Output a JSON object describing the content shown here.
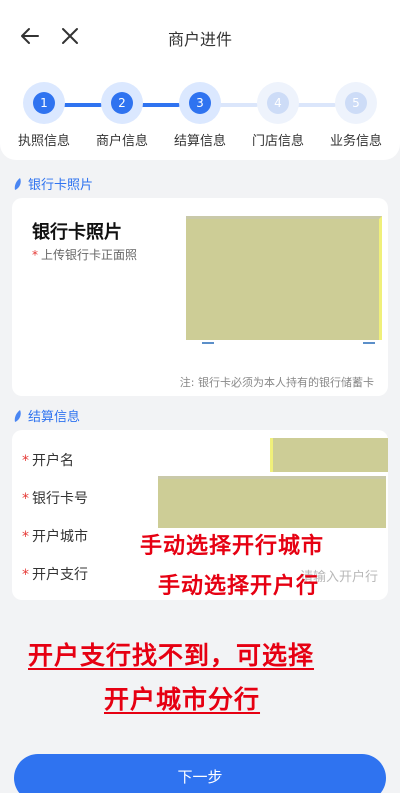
{
  "header": {
    "title": "商户进件"
  },
  "steps": [
    {
      "num": "1",
      "label": "执照信息",
      "state": "active"
    },
    {
      "num": "2",
      "label": "商户信息",
      "state": "active"
    },
    {
      "num": "3",
      "label": "结算信息",
      "state": "active"
    },
    {
      "num": "4",
      "label": "门店信息",
      "state": "inactive"
    },
    {
      "num": "5",
      "label": "业务信息",
      "state": "inactive"
    }
  ],
  "bank_section": {
    "title": "银行卡照片",
    "card_title": "银行卡照片",
    "upload_hint": "上传银行卡正面照",
    "note": "注: 银行卡必须为本人持有的银行储蓄卡"
  },
  "settle_section": {
    "title": "结算信息",
    "fields": {
      "account_name": "开户名",
      "card_number": "银行卡号",
      "city": "开户城市",
      "branch": "开户支行"
    },
    "branch_placeholder": "请输入开户行"
  },
  "annotations": {
    "line1": "手动选择开行城市",
    "line2": "手动选择开户行",
    "line3": "开户支行找不到，可选择",
    "line4": "开户城市分行"
  },
  "footer": {
    "next_label": "下一步"
  },
  "colors": {
    "accent": "#2f73f0",
    "annotation": "#e60012"
  }
}
